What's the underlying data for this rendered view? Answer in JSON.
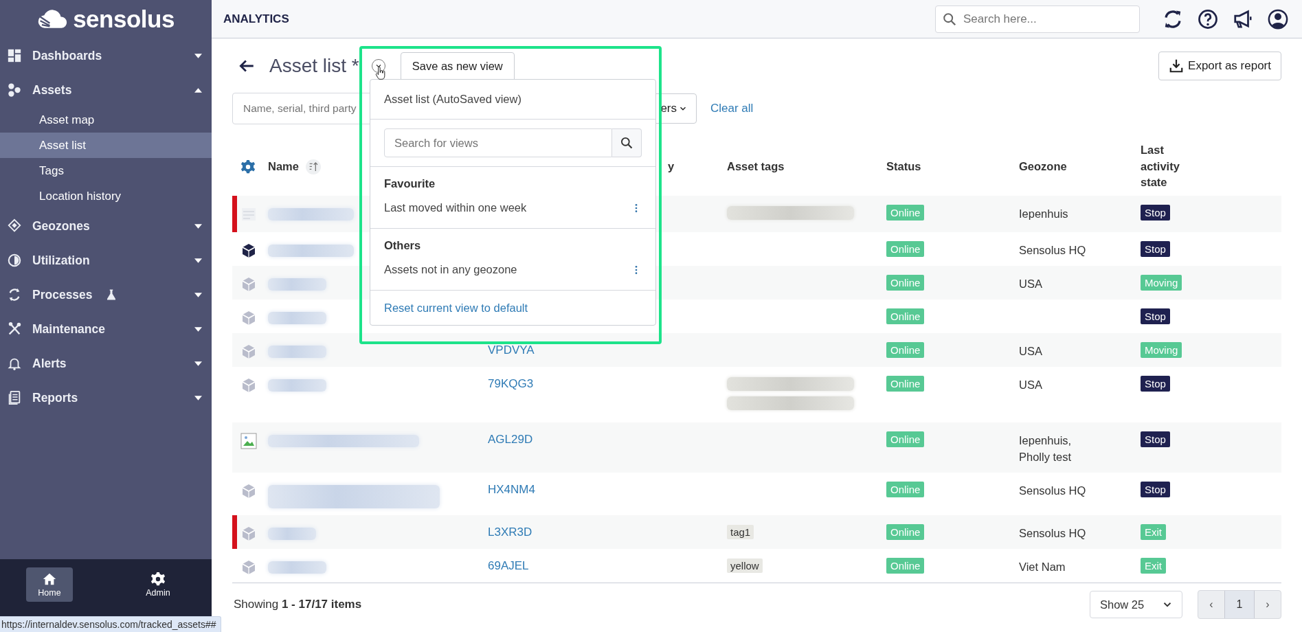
{
  "sidebar": {
    "logo": "sensolus",
    "items": [
      {
        "label": "Dashboards",
        "expanded": false
      },
      {
        "label": "Assets",
        "expanded": true,
        "children": [
          {
            "label": "Asset map",
            "selected": false
          },
          {
            "label": "Asset list",
            "selected": true
          },
          {
            "label": "Tags",
            "selected": false
          },
          {
            "label": "Location history",
            "selected": false
          }
        ]
      },
      {
        "label": "Geozones",
        "expanded": false
      },
      {
        "label": "Utilization",
        "expanded": false
      },
      {
        "label": "Processes",
        "expanded": false
      },
      {
        "label": "Maintenance",
        "expanded": false
      },
      {
        "label": "Alerts",
        "expanded": false
      },
      {
        "label": "Reports",
        "expanded": false
      }
    ],
    "bottom_nav": [
      {
        "label": "Home",
        "selected": true
      },
      {
        "label": "Admin",
        "selected": false
      }
    ]
  },
  "header": {
    "title": "ANALYTICS",
    "search_placeholder": "Search here..."
  },
  "page": {
    "title": "Asset list *",
    "save_button": "Save as new view",
    "export_button": "Export as report"
  },
  "filters": {
    "search_placeholder": "Name, serial, third party",
    "filter_button": "ers",
    "clear": "Clear all"
  },
  "table": {
    "columns": [
      {
        "label": "Name"
      },
      {
        "label": "y"
      },
      {
        "label": "Asset tags"
      },
      {
        "label": "Status"
      },
      {
        "label": "Geozone"
      },
      {
        "label": "Last activity state"
      }
    ],
    "rows": [
      {
        "flagged": true,
        "kind": "faded",
        "tags": [
          {
            "kind": "blurred"
          }
        ],
        "status": {
          "label": "Online",
          "color": "#57c994"
        },
        "geozone": "Iepenhuis",
        "activity": {
          "label": "Stop",
          "color": "#1f2150"
        }
      },
      {
        "flagged": false,
        "kind": "cube_dark",
        "tags": [],
        "status": {
          "label": "Online",
          "color": "#57c994"
        },
        "geozone": "Sensolus HQ",
        "activity": {
          "label": "Stop",
          "color": "#1f2150"
        }
      },
      {
        "flagged": false,
        "kind": "cube",
        "tags": [],
        "status": {
          "label": "Online",
          "color": "#57c994"
        },
        "geozone": "USA",
        "activity": {
          "label": "Moving",
          "color": "#57c994"
        }
      },
      {
        "flagged": false,
        "kind": "cube",
        "tags": [],
        "status": {
          "label": "Online",
          "color": "#57c994"
        },
        "activity": {
          "label": "Stop",
          "color": "#1f2150"
        }
      },
      {
        "flagged": false,
        "kind": "cube",
        "serial": "VPDVYA",
        "tags": [],
        "status": {
          "label": "Online",
          "color": "#57c994"
        },
        "geozone": "USA",
        "activity": {
          "label": "Moving",
          "color": "#57c994"
        }
      },
      {
        "flagged": false,
        "kind": "cube",
        "serial": "79KQG3",
        "tags": [
          {
            "kind": "blurred"
          },
          {
            "kind": "blurred"
          }
        ],
        "status": {
          "label": "Online",
          "color": "#57c994"
        },
        "geozone": "USA",
        "activity": {
          "label": "Stop",
          "color": "#1f2150"
        }
      },
      {
        "flagged": false,
        "kind": "broken_image",
        "serial": "AGL29D",
        "tags": [],
        "status": {
          "label": "Online",
          "color": "#57c994"
        },
        "geozone": "Iepenhuis, Pholly test",
        "activity": {
          "label": "Stop",
          "color": "#1f2150"
        }
      },
      {
        "flagged": false,
        "kind": "cube",
        "serial": "HX4NM4",
        "tags": [],
        "status": {
          "label": "Online",
          "color": "#57c994"
        },
        "geozone": "Sensolus HQ",
        "activity": {
          "label": "Stop",
          "color": "#1f2150"
        }
      },
      {
        "flagged": true,
        "kind": "cube",
        "serial": "L3XR3D",
        "tags": [
          {
            "kind": "text",
            "label": "tag1"
          }
        ],
        "status": {
          "label": "Online",
          "color": "#57c994"
        },
        "geozone": "Sensolus HQ",
        "activity": {
          "label": "Exit",
          "color": "#57c994"
        }
      },
      {
        "flagged": false,
        "kind": "cube",
        "serial": "69AJEL",
        "tags": [
          {
            "kind": "text",
            "label": "yellow"
          }
        ],
        "status": {
          "label": "Online",
          "color": "#57c994"
        },
        "geozone": "Viet Nam",
        "activity": {
          "label": "Exit",
          "color": "#57c994"
        }
      }
    ]
  },
  "footer": {
    "showing": "Showing **1 - 17/17 items**",
    "page_size": "Show 25",
    "prev": "‹",
    "next": "›",
    "pages": [
      {
        "label": "1",
        "selected": true
      }
    ]
  },
  "views_menu": {
    "current": "Asset list (AutoSaved view)",
    "search_placeholder": "Search for views",
    "groups": [
      {
        "title": "Favourite",
        "items": [
          "Last moved within one week"
        ]
      },
      {
        "title": "Others",
        "items": [
          "Assets not in any geozone"
        ]
      }
    ],
    "reset": "Reset current view to default"
  },
  "status_url": "https://internaldev.sensolus.com/tracked_assets##"
}
